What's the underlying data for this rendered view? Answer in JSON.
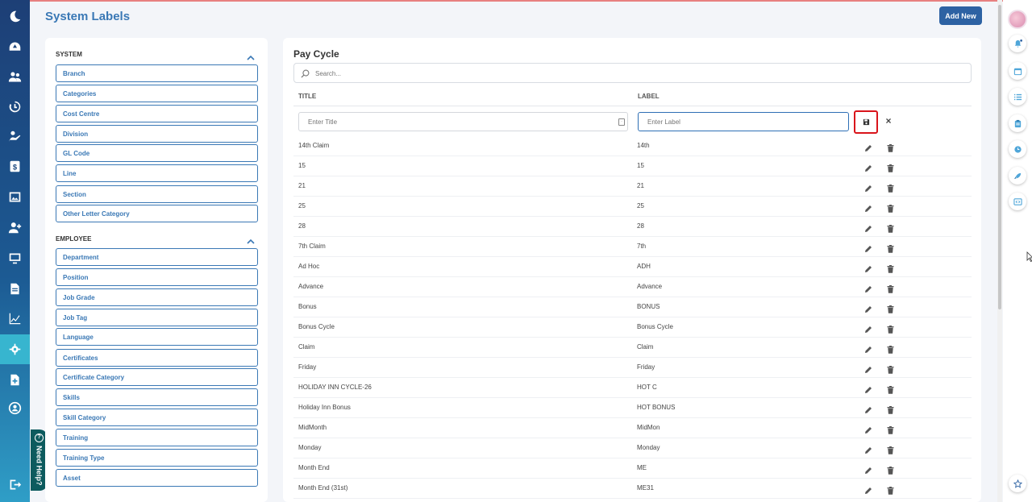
{
  "header": {
    "title": "System Labels",
    "add_new": "Add New"
  },
  "left_panel": {
    "sections": [
      {
        "heading": "SYSTEM",
        "items": [
          "Branch",
          "Categories",
          "Cost Centre",
          "Division",
          "GL Code",
          "Line",
          "Section",
          "Other Letter Category"
        ]
      },
      {
        "heading": "EMPLOYEE",
        "items": [
          "Department",
          "Position",
          "Job Grade",
          "Job Tag",
          "Language",
          "Certificates",
          "Certificate Category",
          "Skills",
          "Skill Category",
          "Training",
          "Training Type",
          "Asset"
        ]
      }
    ]
  },
  "main": {
    "title": "Pay Cycle",
    "search_placeholder": "Search...",
    "col_title": "TITLE",
    "col_label": "LABEL",
    "new_title_placeholder": "Enter Title",
    "new_label_placeholder": "Enter Label",
    "rows": [
      {
        "title": "14th Claim",
        "label": "14th"
      },
      {
        "title": "15",
        "label": "15"
      },
      {
        "title": "21",
        "label": "21"
      },
      {
        "title": "25",
        "label": "25"
      },
      {
        "title": "28",
        "label": "28"
      },
      {
        "title": "7th Claim",
        "label": "7th"
      },
      {
        "title": "Ad Hoc",
        "label": "ADH"
      },
      {
        "title": "Advance",
        "label": "Advance"
      },
      {
        "title": "Bonus",
        "label": "BONUS"
      },
      {
        "title": "Bonus Cycle",
        "label": "Bonus Cycle"
      },
      {
        "title": "Claim",
        "label": "Claim"
      },
      {
        "title": "Friday",
        "label": "Friday"
      },
      {
        "title": "HOLIDAY INN CYCLE-26",
        "label": "HOT C"
      },
      {
        "title": "Holiday Inn Bonus",
        "label": "HOT BONUS"
      },
      {
        "title": "MidMonth",
        "label": "MidMon"
      },
      {
        "title": "Monday",
        "label": "Monday"
      },
      {
        "title": "Month End",
        "label": "ME"
      },
      {
        "title": "Month End (31st)",
        "label": "ME31"
      }
    ]
  },
  "need_help": "Need Help?",
  "sidebar_icons": [
    "moon-logo-icon",
    "dashboard-icon",
    "people-icon",
    "history-icon",
    "presenter-icon",
    "dollar-icon",
    "image-icon",
    "add-user-icon",
    "monitor-icon",
    "document-icon",
    "chart-icon",
    "settings-icon",
    "add-document-icon",
    "account-circle-icon",
    "logout-icon"
  ],
  "rail_icons": [
    "avatar",
    "notification-icon",
    "calendar-icon",
    "list-icon",
    "clipboard-icon",
    "clock-icon",
    "rocket-icon",
    "code-icon",
    "star-icon"
  ],
  "colors": {
    "accent": "#3a78b5",
    "sidebar": "#1d3f76",
    "highlight": "#d9141b",
    "active": "#37b5cf"
  }
}
